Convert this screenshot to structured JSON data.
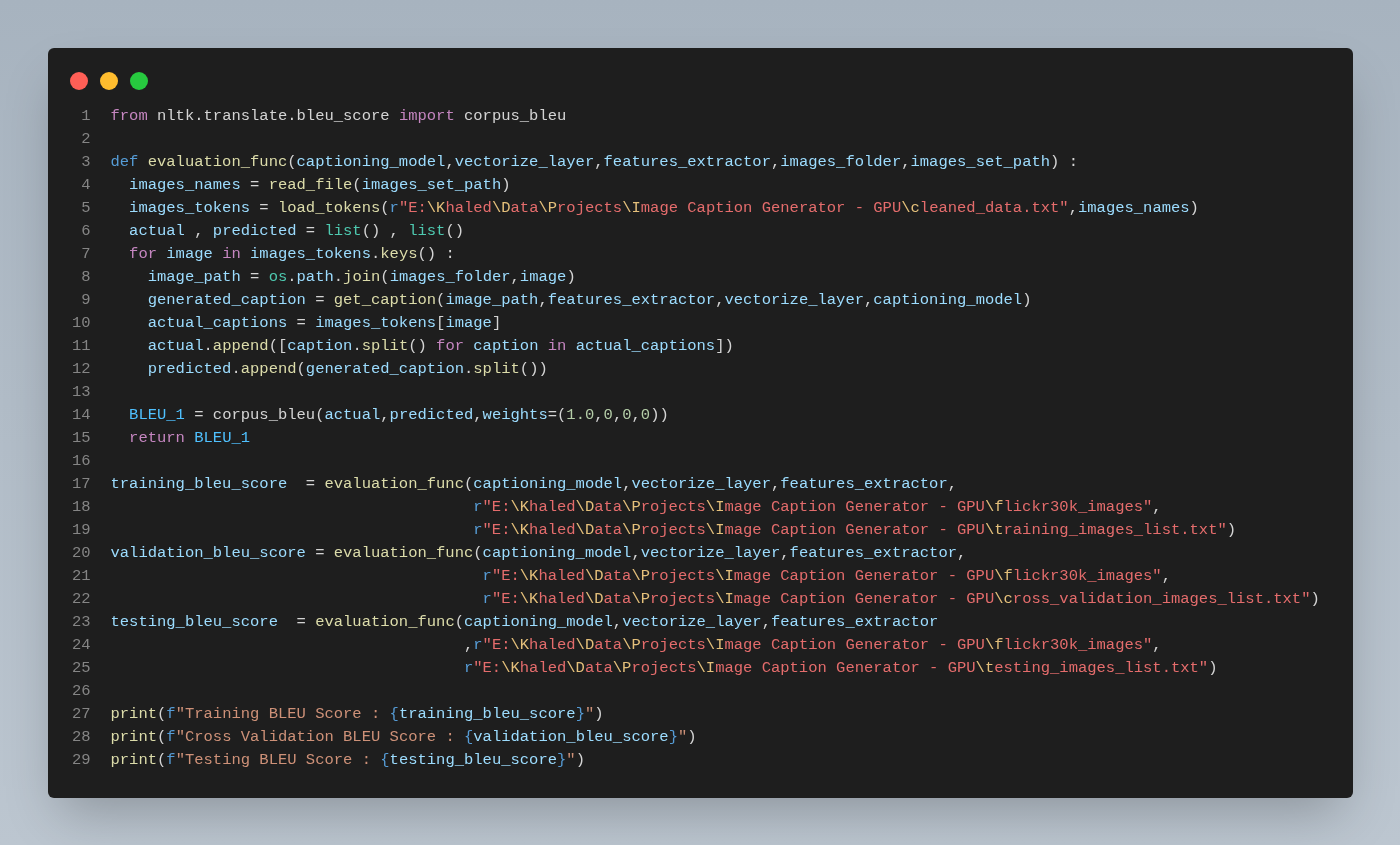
{
  "window_controls": [
    {
      "color": "#ff5f56"
    },
    {
      "color": "#ffbd2e"
    },
    {
      "color": "#27c93f"
    }
  ],
  "lines": [
    {
      "number": "1",
      "tokens": [
        {
          "kind": "kw",
          "text": "from"
        },
        {
          "kind": "op",
          "text": " nltk.translate.bleu_score "
        },
        {
          "kind": "kw",
          "text": "import"
        },
        {
          "kind": "op",
          "text": " corpus_bleu"
        }
      ]
    },
    {
      "number": "2"
    },
    {
      "number": "3",
      "tokens": [
        {
          "kind": "def",
          "text": "def"
        },
        {
          "kind": "fn",
          "text": " evaluation_func"
        },
        {
          "kind": "op",
          "text": "("
        },
        {
          "kind": "var",
          "text": "captioning_model"
        },
        {
          "kind": "op",
          "text": ","
        },
        {
          "kind": "var",
          "text": "vectorize_layer"
        },
        {
          "kind": "op",
          "text": ","
        },
        {
          "kind": "var",
          "text": "features_extractor"
        },
        {
          "kind": "op",
          "text": ","
        },
        {
          "kind": "var",
          "text": "images_folder"
        },
        {
          "kind": "op",
          "text": ","
        },
        {
          "kind": "var",
          "text": "images_set_path"
        },
        {
          "kind": "op",
          "text": ") :"
        }
      ]
    },
    {
      "number": "4",
      "tokens": [
        {
          "kind": "var",
          "text": "  images_names"
        },
        {
          "kind": "op",
          "text": " = "
        },
        {
          "kind": "fn",
          "text": "read_file"
        },
        {
          "kind": "op",
          "text": "("
        },
        {
          "kind": "var",
          "text": "images_set_path"
        },
        {
          "kind": "op",
          "text": ")"
        }
      ]
    },
    {
      "number": "5",
      "tokens": [
        {
          "kind": "var",
          "text": "  images_tokens"
        },
        {
          "kind": "op",
          "text": " = "
        },
        {
          "kind": "fn",
          "text": "load_tokens"
        },
        {
          "kind": "op",
          "text": "("
        },
        {
          "kind": "def",
          "text": "r"
        },
        {
          "kind": "str",
          "text": "\"E:"
        },
        {
          "kind": "esc",
          "text": "\\K"
        },
        {
          "kind": "str",
          "text": "haled"
        },
        {
          "kind": "esc",
          "text": "\\D"
        },
        {
          "kind": "str",
          "text": "ata"
        },
        {
          "kind": "esc",
          "text": "\\P"
        },
        {
          "kind": "str",
          "text": "rojects"
        },
        {
          "kind": "esc",
          "text": "\\I"
        },
        {
          "kind": "str",
          "text": "mage Caption Generator - GPU"
        },
        {
          "kind": "esc",
          "text": "\\c"
        },
        {
          "kind": "str",
          "text": "leaned_data.txt\""
        },
        {
          "kind": "op",
          "text": ","
        },
        {
          "kind": "var",
          "text": "images_names"
        },
        {
          "kind": "op",
          "text": ")"
        }
      ]
    },
    {
      "number": "6",
      "tokens": [
        {
          "kind": "var",
          "text": "  actual"
        },
        {
          "kind": "op",
          "text": " , "
        },
        {
          "kind": "var",
          "text": "predicted"
        },
        {
          "kind": "op",
          "text": " = "
        },
        {
          "kind": "builtin",
          "text": "list"
        },
        {
          "kind": "op",
          "text": "() , "
        },
        {
          "kind": "builtin",
          "text": "list"
        },
        {
          "kind": "op",
          "text": "()"
        }
      ]
    },
    {
      "number": "7",
      "tokens": [
        {
          "kind": "kw",
          "text": "  for"
        },
        {
          "kind": "var",
          "text": " image"
        },
        {
          "kind": "kw",
          "text": " in"
        },
        {
          "kind": "var",
          "text": " images_tokens"
        },
        {
          "kind": "op",
          "text": "."
        },
        {
          "kind": "fn",
          "text": "keys"
        },
        {
          "kind": "op",
          "text": "() :"
        }
      ]
    },
    {
      "number": "8",
      "tokens": [
        {
          "kind": "var",
          "text": "    image_path"
        },
        {
          "kind": "op",
          "text": " = "
        },
        {
          "kind": "builtin",
          "text": "os"
        },
        {
          "kind": "op",
          "text": "."
        },
        {
          "kind": "var",
          "text": "path"
        },
        {
          "kind": "op",
          "text": "."
        },
        {
          "kind": "fn",
          "text": "join"
        },
        {
          "kind": "op",
          "text": "("
        },
        {
          "kind": "var",
          "text": "images_folder"
        },
        {
          "kind": "op",
          "text": ","
        },
        {
          "kind": "var",
          "text": "image"
        },
        {
          "kind": "op",
          "text": ")"
        }
      ]
    },
    {
      "number": "9",
      "tokens": [
        {
          "kind": "var",
          "text": "    generated_caption"
        },
        {
          "kind": "op",
          "text": " = "
        },
        {
          "kind": "fn",
          "text": "get_caption"
        },
        {
          "kind": "op",
          "text": "("
        },
        {
          "kind": "var",
          "text": "image_path"
        },
        {
          "kind": "op",
          "text": ","
        },
        {
          "kind": "var",
          "text": "features_extractor"
        },
        {
          "kind": "op",
          "text": ","
        },
        {
          "kind": "var",
          "text": "vectorize_layer"
        },
        {
          "kind": "op",
          "text": ","
        },
        {
          "kind": "var",
          "text": "captioning_model"
        },
        {
          "kind": "op",
          "text": ")"
        }
      ]
    },
    {
      "number": "10",
      "tokens": [
        {
          "kind": "var",
          "text": "    actual_captions"
        },
        {
          "kind": "op",
          "text": " = "
        },
        {
          "kind": "var",
          "text": "images_tokens"
        },
        {
          "kind": "op",
          "text": "["
        },
        {
          "kind": "var",
          "text": "image"
        },
        {
          "kind": "op",
          "text": "]"
        }
      ]
    },
    {
      "number": "11",
      "tokens": [
        {
          "kind": "var",
          "text": "    actual"
        },
        {
          "kind": "op",
          "text": "."
        },
        {
          "kind": "fn",
          "text": "append"
        },
        {
          "kind": "op",
          "text": "(["
        },
        {
          "kind": "var",
          "text": "caption"
        },
        {
          "kind": "op",
          "text": "."
        },
        {
          "kind": "fn",
          "text": "split"
        },
        {
          "kind": "op",
          "text": "() "
        },
        {
          "kind": "kw",
          "text": "for"
        },
        {
          "kind": "var",
          "text": " caption"
        },
        {
          "kind": "kw",
          "text": " in"
        },
        {
          "kind": "var",
          "text": " actual_captions"
        },
        {
          "kind": "op",
          "text": "])"
        }
      ]
    },
    {
      "number": "12",
      "tokens": [
        {
          "kind": "var",
          "text": "    predicted"
        },
        {
          "kind": "op",
          "text": "."
        },
        {
          "kind": "fn",
          "text": "append"
        },
        {
          "kind": "op",
          "text": "("
        },
        {
          "kind": "var",
          "text": "generated_caption"
        },
        {
          "kind": "op",
          "text": "."
        },
        {
          "kind": "fn",
          "text": "split"
        },
        {
          "kind": "op",
          "text": "())"
        }
      ]
    },
    {
      "number": "13"
    },
    {
      "number": "14",
      "tokens": [
        {
          "kind": "const",
          "text": "  BLEU_1"
        },
        {
          "kind": "op",
          "text": " = corpus_bleu("
        },
        {
          "kind": "var",
          "text": "actual"
        },
        {
          "kind": "op",
          "text": ","
        },
        {
          "kind": "var",
          "text": "predicted"
        },
        {
          "kind": "op",
          "text": ","
        },
        {
          "kind": "var",
          "text": "weights"
        },
        {
          "kind": "op",
          "text": "=("
        },
        {
          "kind": "num",
          "text": "1.0"
        },
        {
          "kind": "op",
          "text": ","
        },
        {
          "kind": "num",
          "text": "0"
        },
        {
          "kind": "op",
          "text": ","
        },
        {
          "kind": "num",
          "text": "0"
        },
        {
          "kind": "op",
          "text": ","
        },
        {
          "kind": "num",
          "text": "0"
        },
        {
          "kind": "op",
          "text": "))"
        }
      ]
    },
    {
      "number": "15",
      "tokens": [
        {
          "kind": "kw",
          "text": "  return"
        },
        {
          "kind": "const",
          "text": " BLEU_1"
        }
      ]
    },
    {
      "number": "16"
    },
    {
      "number": "17",
      "tokens": [
        {
          "kind": "var",
          "text": "training_bleu_score"
        },
        {
          "kind": "op",
          "text": "  = "
        },
        {
          "kind": "fn",
          "text": "evaluation_func"
        },
        {
          "kind": "op",
          "text": "("
        },
        {
          "kind": "var",
          "text": "captioning_model"
        },
        {
          "kind": "op",
          "text": ","
        },
        {
          "kind": "var",
          "text": "vectorize_layer"
        },
        {
          "kind": "op",
          "text": ","
        },
        {
          "kind": "var",
          "text": "features_extractor"
        },
        {
          "kind": "op",
          "text": ","
        }
      ]
    },
    {
      "number": "18",
      "tokens": [
        {
          "kind": "def",
          "text": "                                       r"
        },
        {
          "kind": "str",
          "text": "\"E:"
        },
        {
          "kind": "esc",
          "text": "\\K"
        },
        {
          "kind": "str",
          "text": "haled"
        },
        {
          "kind": "esc",
          "text": "\\D"
        },
        {
          "kind": "str",
          "text": "ata"
        },
        {
          "kind": "esc",
          "text": "\\P"
        },
        {
          "kind": "str",
          "text": "rojects"
        },
        {
          "kind": "esc",
          "text": "\\I"
        },
        {
          "kind": "str",
          "text": "mage Caption Generator - GPU"
        },
        {
          "kind": "esc",
          "text": "\\f"
        },
        {
          "kind": "str",
          "text": "lickr30k_images\""
        },
        {
          "kind": "op",
          "text": ","
        }
      ]
    },
    {
      "number": "19",
      "tokens": [
        {
          "kind": "def",
          "text": "                                       r"
        },
        {
          "kind": "str",
          "text": "\"E:"
        },
        {
          "kind": "esc",
          "text": "\\K"
        },
        {
          "kind": "str",
          "text": "haled"
        },
        {
          "kind": "esc",
          "text": "\\D"
        },
        {
          "kind": "str",
          "text": "ata"
        },
        {
          "kind": "esc",
          "text": "\\P"
        },
        {
          "kind": "str",
          "text": "rojects"
        },
        {
          "kind": "esc",
          "text": "\\I"
        },
        {
          "kind": "str",
          "text": "mage Caption Generator - GPU"
        },
        {
          "kind": "esc",
          "text": "\\t"
        },
        {
          "kind": "str",
          "text": "raining_images_list.txt\""
        },
        {
          "kind": "op",
          "text": ")"
        }
      ]
    },
    {
      "number": "20",
      "tokens": [
        {
          "kind": "var",
          "text": "validation_bleu_score"
        },
        {
          "kind": "op",
          "text": " = "
        },
        {
          "kind": "fn",
          "text": "evaluation_func"
        },
        {
          "kind": "op",
          "text": "("
        },
        {
          "kind": "var",
          "text": "captioning_model"
        },
        {
          "kind": "op",
          "text": ","
        },
        {
          "kind": "var",
          "text": "vectorize_layer"
        },
        {
          "kind": "op",
          "text": ","
        },
        {
          "kind": "var",
          "text": "features_extractor"
        },
        {
          "kind": "op",
          "text": ","
        }
      ]
    },
    {
      "number": "21",
      "tokens": [
        {
          "kind": "def",
          "text": "                                        r"
        },
        {
          "kind": "str",
          "text": "\"E:"
        },
        {
          "kind": "esc",
          "text": "\\K"
        },
        {
          "kind": "str",
          "text": "haled"
        },
        {
          "kind": "esc",
          "text": "\\D"
        },
        {
          "kind": "str",
          "text": "ata"
        },
        {
          "kind": "esc",
          "text": "\\P"
        },
        {
          "kind": "str",
          "text": "rojects"
        },
        {
          "kind": "esc",
          "text": "\\I"
        },
        {
          "kind": "str",
          "text": "mage Caption Generator - GPU"
        },
        {
          "kind": "esc",
          "text": "\\f"
        },
        {
          "kind": "str",
          "text": "lickr30k_images\""
        },
        {
          "kind": "op",
          "text": ","
        }
      ]
    },
    {
      "number": "22",
      "tokens": [
        {
          "kind": "def",
          "text": "                                        r"
        },
        {
          "kind": "str",
          "text": "\"E:"
        },
        {
          "kind": "esc",
          "text": "\\K"
        },
        {
          "kind": "str",
          "text": "haled"
        },
        {
          "kind": "esc",
          "text": "\\D"
        },
        {
          "kind": "str",
          "text": "ata"
        },
        {
          "kind": "esc",
          "text": "\\P"
        },
        {
          "kind": "str",
          "text": "rojects"
        },
        {
          "kind": "esc",
          "text": "\\I"
        },
        {
          "kind": "str",
          "text": "mage Caption Generator - GPU"
        },
        {
          "kind": "esc",
          "text": "\\c"
        },
        {
          "kind": "str",
          "text": "ross_validation_images_list.txt\""
        },
        {
          "kind": "op",
          "text": ")"
        }
      ]
    },
    {
      "number": "23",
      "tokens": [
        {
          "kind": "var",
          "text": "testing_bleu_score"
        },
        {
          "kind": "op",
          "text": "  = "
        },
        {
          "kind": "fn",
          "text": "evaluation_func"
        },
        {
          "kind": "op",
          "text": "("
        },
        {
          "kind": "var",
          "text": "captioning_model"
        },
        {
          "kind": "op",
          "text": ","
        },
        {
          "kind": "var",
          "text": "vectorize_layer"
        },
        {
          "kind": "op",
          "text": ","
        },
        {
          "kind": "var",
          "text": "features_extractor"
        }
      ]
    },
    {
      "number": "24",
      "tokens": [
        {
          "kind": "op",
          "text": "                                      ,"
        },
        {
          "kind": "def",
          "text": "r"
        },
        {
          "kind": "str",
          "text": "\"E:"
        },
        {
          "kind": "esc",
          "text": "\\K"
        },
        {
          "kind": "str",
          "text": "haled"
        },
        {
          "kind": "esc",
          "text": "\\D"
        },
        {
          "kind": "str",
          "text": "ata"
        },
        {
          "kind": "esc",
          "text": "\\P"
        },
        {
          "kind": "str",
          "text": "rojects"
        },
        {
          "kind": "esc",
          "text": "\\I"
        },
        {
          "kind": "str",
          "text": "mage Caption Generator - GPU"
        },
        {
          "kind": "esc",
          "text": "\\f"
        },
        {
          "kind": "str",
          "text": "lickr30k_images\""
        },
        {
          "kind": "op",
          "text": ","
        }
      ]
    },
    {
      "number": "25",
      "tokens": [
        {
          "kind": "def",
          "text": "                                      r"
        },
        {
          "kind": "str",
          "text": "\"E:"
        },
        {
          "kind": "esc",
          "text": "\\K"
        },
        {
          "kind": "str",
          "text": "haled"
        },
        {
          "kind": "esc",
          "text": "\\D"
        },
        {
          "kind": "str",
          "text": "ata"
        },
        {
          "kind": "esc",
          "text": "\\P"
        },
        {
          "kind": "str",
          "text": "rojects"
        },
        {
          "kind": "esc",
          "text": "\\I"
        },
        {
          "kind": "str",
          "text": "mage Caption Generator - GPU"
        },
        {
          "kind": "esc",
          "text": "\\t"
        },
        {
          "kind": "str",
          "text": "esting_images_list.txt\""
        },
        {
          "kind": "op",
          "text": ")"
        }
      ]
    },
    {
      "number": "26"
    },
    {
      "number": "27",
      "tokens": [
        {
          "kind": "fn",
          "text": "print"
        },
        {
          "kind": "op",
          "text": "("
        },
        {
          "kind": "def",
          "text": "f"
        },
        {
          "kind": "fstr",
          "text": "\"Training BLEU Score : "
        },
        {
          "kind": "brace",
          "text": "{"
        },
        {
          "kind": "var",
          "text": "training_bleu_score"
        },
        {
          "kind": "brace",
          "text": "}"
        },
        {
          "kind": "fstr",
          "text": "\""
        },
        {
          "kind": "op",
          "text": ")"
        }
      ]
    },
    {
      "number": "28",
      "tokens": [
        {
          "kind": "fn",
          "text": "print"
        },
        {
          "kind": "op",
          "text": "("
        },
        {
          "kind": "def",
          "text": "f"
        },
        {
          "kind": "fstr",
          "text": "\"Cross Validation BLEU Score : "
        },
        {
          "kind": "brace",
          "text": "{"
        },
        {
          "kind": "var",
          "text": "validation_bleu_score"
        },
        {
          "kind": "brace",
          "text": "}"
        },
        {
          "kind": "fstr",
          "text": "\""
        },
        {
          "kind": "op",
          "text": ")"
        }
      ]
    },
    {
      "number": "29",
      "tokens": [
        {
          "kind": "fn",
          "text": "print"
        },
        {
          "kind": "op",
          "text": "("
        },
        {
          "kind": "def",
          "text": "f"
        },
        {
          "kind": "fstr",
          "text": "\"Testing BLEU Score : "
        },
        {
          "kind": "brace",
          "text": "{"
        },
        {
          "kind": "var",
          "text": "testing_bleu_score"
        },
        {
          "kind": "brace",
          "text": "}"
        },
        {
          "kind": "fstr",
          "text": "\""
        },
        {
          "kind": "op",
          "text": ")"
        }
      ]
    }
  ]
}
